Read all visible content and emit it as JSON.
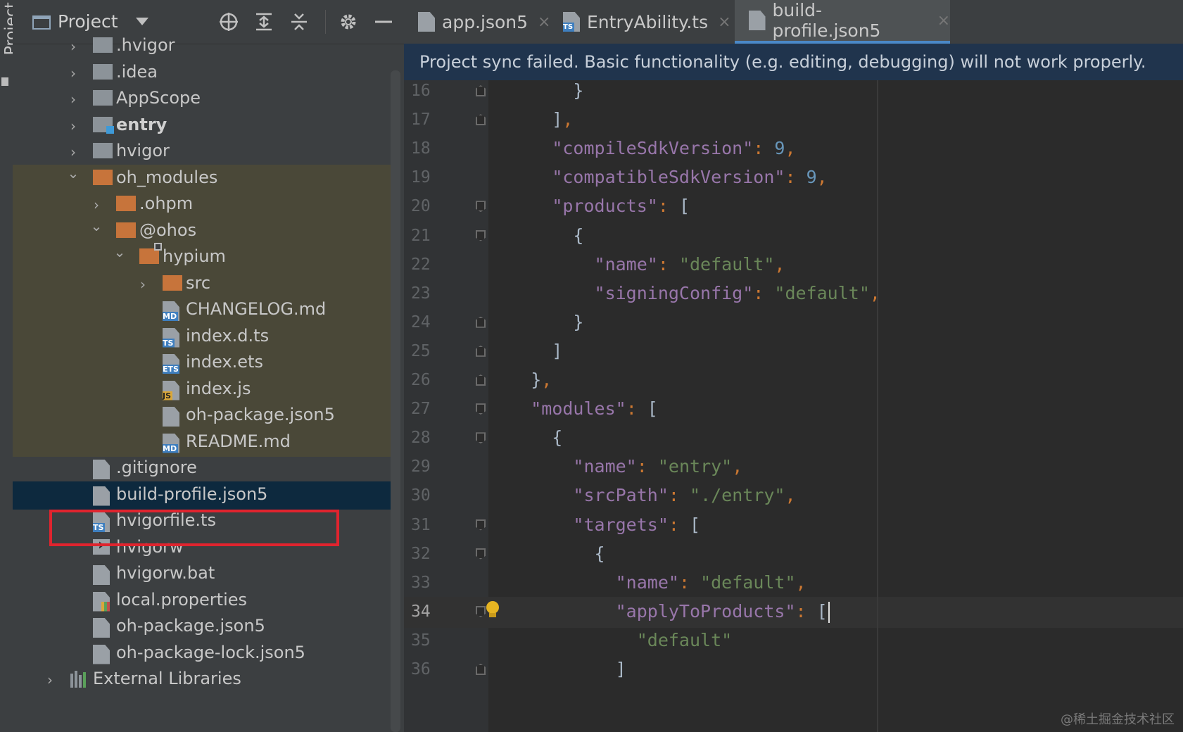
{
  "tool_strip": {
    "label": "Project"
  },
  "project_panel": {
    "title": "Project",
    "tree": [
      {
        "label": ".hvigor",
        "icon": "folder-grey",
        "expanded": false,
        "bold": false
      },
      {
        "label": ".idea",
        "icon": "folder-grey",
        "expanded": false,
        "bold": false
      },
      {
        "label": "AppScope",
        "icon": "folder-grey",
        "expanded": false,
        "bold": false
      },
      {
        "label": "entry",
        "icon": "module-folder",
        "expanded": false,
        "bold": true
      },
      {
        "label": "hvigor",
        "icon": "folder-grey",
        "expanded": false,
        "bold": false
      },
      {
        "label": "oh_modules",
        "icon": "folder-orange",
        "expanded": true,
        "bold": false
      },
      {
        "label": ".ohpm",
        "icon": "folder-orange",
        "expanded": false,
        "bold": false
      },
      {
        "label": "@ohos",
        "icon": "folder-orange",
        "expanded": true,
        "bold": false
      },
      {
        "label": "hypium",
        "icon": "folder-orange-link",
        "expanded": true,
        "bold": false
      },
      {
        "label": "src",
        "icon": "folder-orange",
        "expanded": false,
        "bold": false
      },
      {
        "label": "CHANGELOG.md",
        "icon": "file-md",
        "bold": false
      },
      {
        "label": "index.d.ts",
        "icon": "file-ts",
        "bold": false
      },
      {
        "label": "index.ets",
        "icon": "file-ets",
        "bold": false
      },
      {
        "label": "index.js",
        "icon": "file-js",
        "bold": false
      },
      {
        "label": "oh-package.json5",
        "icon": "file-json5",
        "bold": false
      },
      {
        "label": "README.md",
        "icon": "file-md",
        "bold": false
      },
      {
        "label": ".gitignore",
        "icon": "file-gitignore",
        "bold": false
      },
      {
        "label": "build-profile.json5",
        "icon": "file-json5",
        "bold": false,
        "selected": true
      },
      {
        "label": "hvigorfile.ts",
        "icon": "file-ts",
        "bold": false
      },
      {
        "label": "hvigorw",
        "icon": "file-exec",
        "bold": false
      },
      {
        "label": "hvigorw.bat",
        "icon": "file-text",
        "bold": false
      },
      {
        "label": "local.properties",
        "icon": "file-properties",
        "bold": false
      },
      {
        "label": "oh-package.json5",
        "icon": "file-json5",
        "bold": false
      },
      {
        "label": "oh-package-lock.json5",
        "icon": "file-json5",
        "bold": false
      },
      {
        "label": "External Libraries",
        "icon": "libraries-icon",
        "expanded": false,
        "bold": false
      }
    ]
  },
  "editor": {
    "tabs": [
      {
        "label": "app.json5",
        "icon": "json5-file-icon",
        "active": false
      },
      {
        "label": "EntryAbility.ts",
        "icon": "ts-file-icon",
        "active": false
      },
      {
        "label": "build-profile.json5",
        "icon": "json5-file-icon",
        "active": true
      }
    ],
    "close_glyph": "×",
    "banner": "Project sync failed. Basic functionality (e.g. editing, debugging) will not work properly.",
    "current_line": 34,
    "lines": [
      {
        "n": "16",
        "text": "        }"
      },
      {
        "n": "17",
        "text": "      ],"
      },
      {
        "n": "18",
        "text": "      \"compileSdkVersion\": 9,"
      },
      {
        "n": "19",
        "text": "      \"compatibleSdkVersion\": 9,"
      },
      {
        "n": "20",
        "text": "      \"products\": ["
      },
      {
        "n": "21",
        "text": "        {"
      },
      {
        "n": "22",
        "text": "          \"name\": \"default\","
      },
      {
        "n": "23",
        "text": "          \"signingConfig\": \"default\","
      },
      {
        "n": "24",
        "text": "        }"
      },
      {
        "n": "25",
        "text": "      ]"
      },
      {
        "n": "26",
        "text": "    },"
      },
      {
        "n": "27",
        "text": "    \"modules\": ["
      },
      {
        "n": "28",
        "text": "      {"
      },
      {
        "n": "29",
        "text": "        \"name\": \"entry\","
      },
      {
        "n": "30",
        "text": "        \"srcPath\": \"./entry\","
      },
      {
        "n": "31",
        "text": "        \"targets\": ["
      },
      {
        "n": "32",
        "text": "          {"
      },
      {
        "n": "33",
        "text": "            \"name\": \"default\","
      },
      {
        "n": "34",
        "text": "            \"applyToProducts\": ["
      },
      {
        "n": "35",
        "text": "              \"default\""
      },
      {
        "n": "36",
        "text": "            ]"
      }
    ]
  },
  "watermark": "@稀土掘金技术社区",
  "colors": {
    "selection_outline": "#e0242e",
    "banner_bg": "#20344d",
    "key": "#9876aa",
    "string": "#6a8759",
    "number": "#6897bb",
    "punct": "#cc7832"
  }
}
